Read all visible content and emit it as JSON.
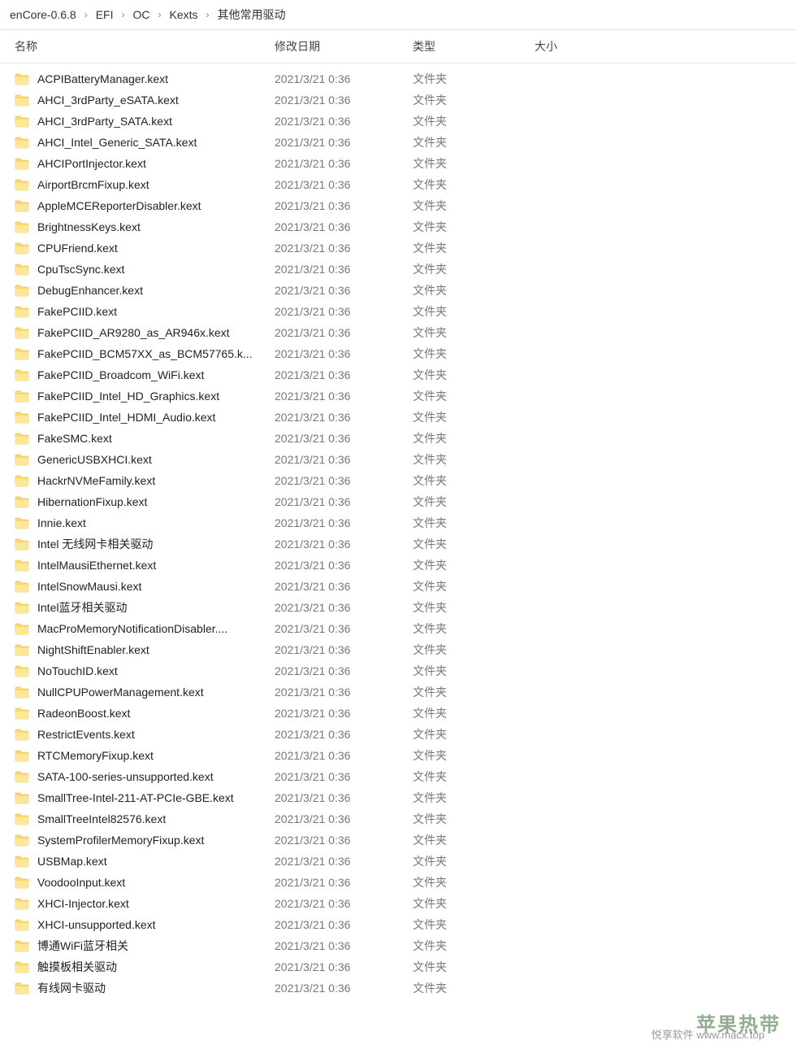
{
  "breadcrumb": [
    "enCore-0.6.8",
    "EFI",
    "OC",
    "Kexts",
    "其他常用驱动"
  ],
  "columns": {
    "name": "名称",
    "date": "修改日期",
    "type": "类型",
    "size": "大小"
  },
  "type_label": "文件夹",
  "date_value": "2021/3/21 0:36",
  "files": [
    "ACPIBatteryManager.kext",
    "AHCI_3rdParty_eSATA.kext",
    "AHCI_3rdParty_SATA.kext",
    "AHCI_Intel_Generic_SATA.kext",
    "AHCIPortInjector.kext",
    "AirportBrcmFixup.kext",
    "AppleMCEReporterDisabler.kext",
    "BrightnessKeys.kext",
    "CPUFriend.kext",
    "CpuTscSync.kext",
    "DebugEnhancer.kext",
    "FakePCIID.kext",
    "FakePCIID_AR9280_as_AR946x.kext",
    "FakePCIID_BCM57XX_as_BCM57765.k...",
    "FakePCIID_Broadcom_WiFi.kext",
    "FakePCIID_Intel_HD_Graphics.kext",
    "FakePCIID_Intel_HDMI_Audio.kext",
    "FakeSMC.kext",
    "GenericUSBXHCI.kext",
    "HackrNVMeFamily.kext",
    "HibernationFixup.kext",
    "Innie.kext",
    "Intel 无线网卡相关驱动",
    "IntelMausiEthernet.kext",
    "IntelSnowMausi.kext",
    "Intel蓝牙相关驱动",
    "MacProMemoryNotificationDisabler....",
    "NightShiftEnabler.kext",
    "NoTouchID.kext",
    "NullCPUPowerManagement.kext",
    "RadeonBoost.kext",
    "RestrictEvents.kext",
    "RTCMemoryFixup.kext",
    "SATA-100-series-unsupported.kext",
    "SmallTree-Intel-211-AT-PCIe-GBE.kext",
    "SmallTreeIntel82576.kext",
    "SystemProfilerMemoryFixup.kext",
    "USBMap.kext",
    "VoodooInput.kext",
    "XHCI-Injector.kext",
    "XHCI-unsupported.kext",
    "博通WiFi蓝牙相关",
    "触摸板相关驱动",
    "有线网卡驱动"
  ],
  "watermark": {
    "main": "苹果热带",
    "sub": "悦享软件  www.macx.top"
  }
}
